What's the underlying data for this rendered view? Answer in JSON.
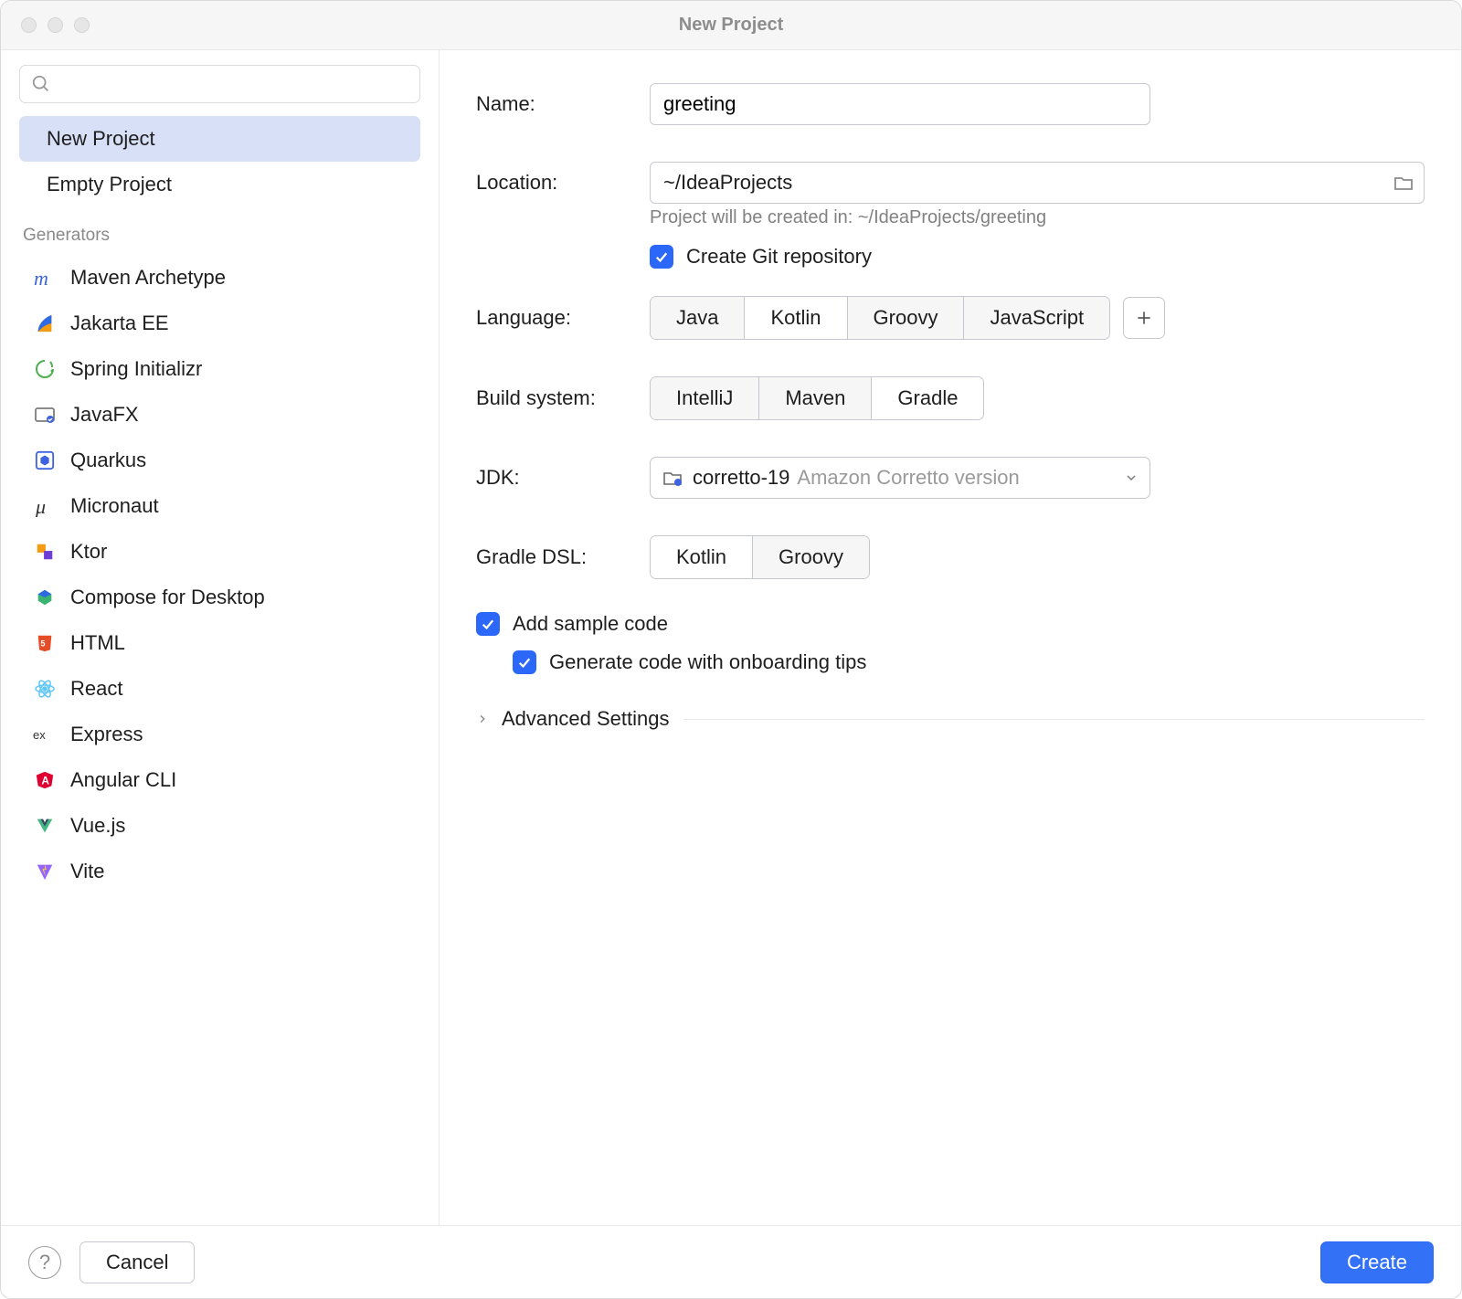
{
  "window_title": "New Project",
  "search": {
    "placeholder": ""
  },
  "sidebar": {
    "project_types": [
      {
        "label": "New Project"
      },
      {
        "label": "Empty Project"
      }
    ],
    "generators_header": "Generators",
    "generators": [
      {
        "label": "Maven Archetype"
      },
      {
        "label": "Jakarta EE"
      },
      {
        "label": "Spring Initializr"
      },
      {
        "label": "JavaFX"
      },
      {
        "label": "Quarkus"
      },
      {
        "label": "Micronaut"
      },
      {
        "label": "Ktor"
      },
      {
        "label": "Compose for Desktop"
      },
      {
        "label": "HTML"
      },
      {
        "label": "React"
      },
      {
        "label": "Express"
      },
      {
        "label": "Angular CLI"
      },
      {
        "label": "Vue.js"
      },
      {
        "label": "Vite"
      }
    ]
  },
  "form": {
    "name_label": "Name:",
    "name_value": "greeting",
    "location_label": "Location:",
    "location_value": "~/IdeaProjects",
    "location_hint": "Project will be created in: ~/IdeaProjects/greeting",
    "git_label": "Create Git repository",
    "language_label": "Language:",
    "languages": [
      "Java",
      "Kotlin",
      "Groovy",
      "JavaScript"
    ],
    "language_selected_index": 1,
    "build_label": "Build system:",
    "build_systems": [
      "IntelliJ",
      "Maven",
      "Gradle"
    ],
    "build_selected_index": 2,
    "jdk_label": "JDK:",
    "jdk_name": "corretto-19",
    "jdk_desc": "Amazon Corretto version",
    "dsl_label": "Gradle DSL:",
    "dsls": [
      "Kotlin",
      "Groovy"
    ],
    "dsl_selected_index": 0,
    "sample_label": "Add sample code",
    "onboarding_label": "Generate code with onboarding tips",
    "advanced_label": "Advanced Settings"
  },
  "footer": {
    "cancel": "Cancel",
    "create": "Create"
  }
}
